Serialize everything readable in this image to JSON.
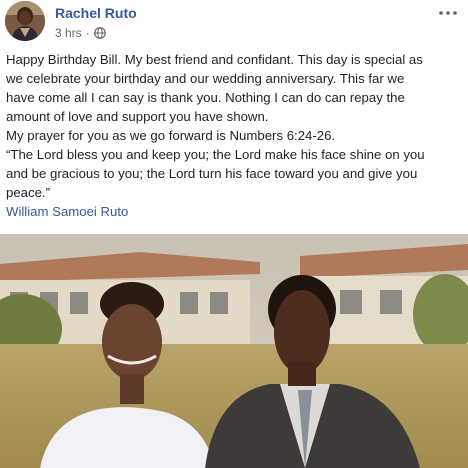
{
  "post": {
    "author": "Rachel Ruto",
    "timestamp": "3 hrs",
    "separator": "·",
    "privacy_icon": "globe-icon",
    "options_icon": "more-options-icon",
    "lines": [
      "Happy Birthday Bill. My best friend and confidant. This day is special as",
      "we celebrate your birthday and our wedding anniversary. This far we",
      "have come all I can say is thank you. Nothing I can do can repay the",
      "amount of love and support you have shown.",
      "My prayer for you as we go forward is Numbers 6:24-26.",
      "“The Lord bless you and keep you; the Lord make his face shine on you",
      "and be gracious to you; the Lord turn his face toward you and give you",
      "peace.”"
    ],
    "tagged": "William Samoei Ruto"
  },
  "colors": {
    "link": "#385898",
    "text": "#1d2129",
    "meta": "#616770"
  }
}
